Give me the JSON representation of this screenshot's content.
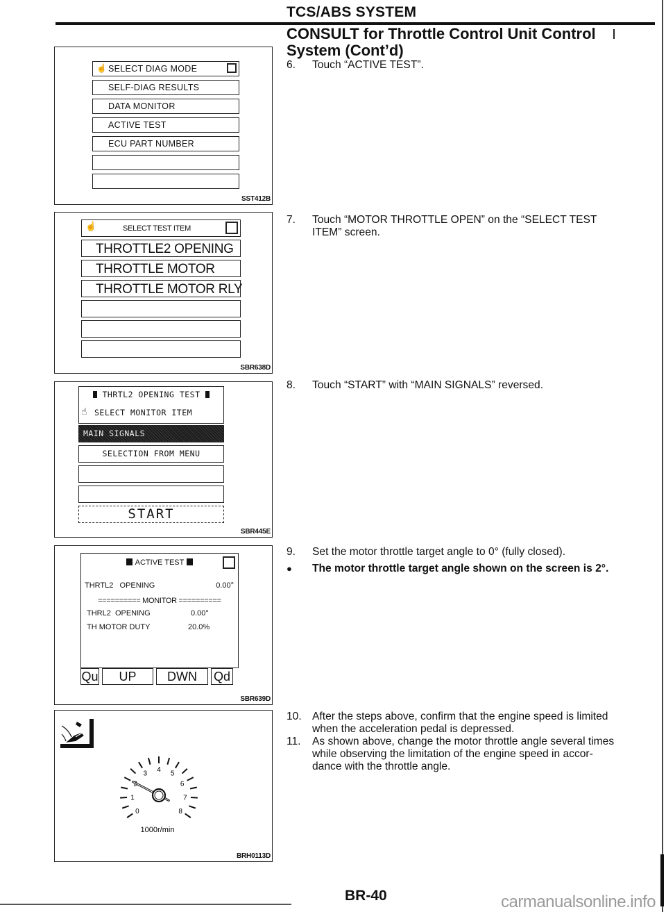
{
  "header": {
    "section_title": "TCS/ABS SYSTEM",
    "subtitle_line1": "CONSULT for Throttle Control Unit Control",
    "subtitle_line2": "System (Cont’d)"
  },
  "figures": {
    "fig1": {
      "code": "SST412B",
      "header_icon": "hand-pointer-icon",
      "header": "SELECT DIAG MODE",
      "items": [
        "SELF-DIAG RESULTS",
        "DATA MONITOR",
        "ACTIVE TEST",
        "ECU PART NUMBER",
        "",
        ""
      ]
    },
    "fig2": {
      "code": "SBR638D",
      "header_icon": "hand-pointer-icon",
      "header": "SELECT TEST ITEM",
      "items": [
        "THROTTLE2 OPENING",
        "THROTTLE MOTOR",
        "THROTTLE MOTOR RLY",
        "",
        "",
        ""
      ]
    },
    "fig3": {
      "code": "SBR445E",
      "title": "THRTL2 OPENING TEST",
      "prompt": "SELECT MONITOR ITEM",
      "prompt_icon": "hand-pointer-icon",
      "items": [
        "MAIN SIGNALS",
        "SELECTION FROM MENU",
        "",
        ""
      ],
      "selected_item": "MAIN SIGNALS",
      "start_label": "START"
    },
    "fig4": {
      "code": "SBR639D",
      "title": "ACTIVE TEST",
      "test_item": {
        "label": "THRTL2   OPENING",
        "value": "0.00°"
      },
      "monitor_separator": "========== MONITOR ==========",
      "monitor_items": [
        {
          "label": "THRL2  OPENING",
          "value": "0.00°"
        },
        {
          "label": "TH MOTOR DUTY",
          "value": "20.0%"
        }
      ],
      "buttons": {
        "qu": "Qu",
        "up": "UP",
        "dwn": "DWN",
        "qd": "Qd"
      }
    },
    "fig5": {
      "code": "BRH0113D",
      "pedal_icon": "accelerator-pedal-icon",
      "gauge": {
        "unit_label": "1000r/min",
        "tick_labels": [
          "0",
          "1",
          "2",
          "3",
          "4",
          "5",
          "6",
          "7",
          "8"
        ],
        "needle_value": 2
      }
    }
  },
  "steps": [
    {
      "num": "6.",
      "text": "Touch “ACTIVE TEST”."
    },
    {
      "num": "7.",
      "line1": "Touch “MOTOR THROTTLE OPEN” on the “SELECT TEST",
      "line2": "ITEM” screen."
    },
    {
      "num": "8.",
      "text": "Touch “START” with “MAIN SIGNALS” reversed."
    },
    {
      "num": "9.",
      "text": "Set the motor throttle target angle to 0° (fully closed)."
    },
    {
      "bullet": "●",
      "text": "The motor throttle target angle shown on the screen is 2°."
    },
    {
      "num": "10.",
      "line1": "After the steps above, confirm that the engine speed is limited",
      "line2": "when the acceleration pedal is depressed."
    },
    {
      "num": "11.",
      "line1": "As shown above, change the motor throttle angle several times",
      "line2": "while observing the limitation of the engine speed in accor-",
      "line3": "dance with the throttle angle."
    }
  ],
  "footer": {
    "page_number": "BR-40",
    "watermark": "carmanualsonline.info"
  }
}
